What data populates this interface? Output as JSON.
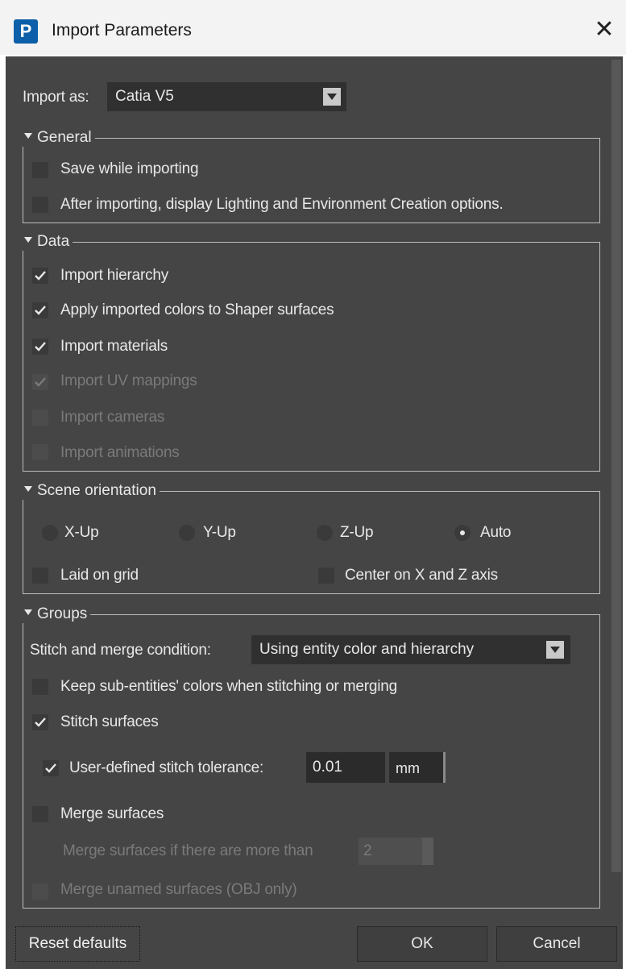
{
  "window": {
    "app_icon_letter": "P",
    "title": "Import Parameters",
    "close_symbol": "✕"
  },
  "import_as": {
    "label": "Import as:",
    "value": "Catia V5"
  },
  "general": {
    "title": "General",
    "items": [
      {
        "label": "Save while importing",
        "checked": false,
        "enabled": true
      },
      {
        "label": "After importing, display Lighting and Environment Creation options.",
        "checked": false,
        "enabled": true
      }
    ]
  },
  "data_section": {
    "title": "Data",
    "items": [
      {
        "label": "Import hierarchy",
        "checked": true,
        "enabled": true
      },
      {
        "label": "Apply imported colors to Shaper surfaces",
        "checked": true,
        "enabled": true
      },
      {
        "label": "Import materials",
        "checked": true,
        "enabled": true
      },
      {
        "label": "Import UV mappings",
        "checked": true,
        "enabled": false
      },
      {
        "label": "Import cameras",
        "checked": false,
        "enabled": false
      },
      {
        "label": "Import animations",
        "checked": false,
        "enabled": false
      }
    ]
  },
  "scene_orientation": {
    "title": "Scene orientation",
    "options": [
      "X-Up",
      "Y-Up",
      "Z-Up",
      "Auto"
    ],
    "selected": "Auto",
    "laid_on_grid": {
      "label": "Laid on grid",
      "checked": false
    },
    "center_xz": {
      "label": "Center on X and Z axis",
      "checked": false
    }
  },
  "groups": {
    "title": "Groups",
    "stitch_merge_label": "Stitch and merge condition:",
    "stitch_merge_value": "Using entity color and hierarchy",
    "keep_colors": {
      "label": "Keep sub-entities' colors when stitching or merging",
      "checked": false
    },
    "stitch_surfaces": {
      "label": "Stitch surfaces",
      "checked": true
    },
    "user_tolerance": {
      "label": "User-defined stitch tolerance:",
      "checked": true,
      "value": "0.01",
      "unit": "mm"
    },
    "merge_surfaces": {
      "label": "Merge surfaces",
      "checked": false
    },
    "merge_if_more": {
      "label": "Merge surfaces if there are more than",
      "value": "2"
    },
    "merge_unnamed": {
      "label": "Merge unamed surfaces (OBJ only)",
      "checked": false
    }
  },
  "buttons": {
    "reset": "Reset defaults",
    "ok": "OK",
    "cancel": "Cancel"
  },
  "colors": {
    "panel_bg": "#454545",
    "text": "#e8e8e8",
    "disabled_text": "#7a7a7a",
    "brand_blue": "#0c5fa8"
  }
}
